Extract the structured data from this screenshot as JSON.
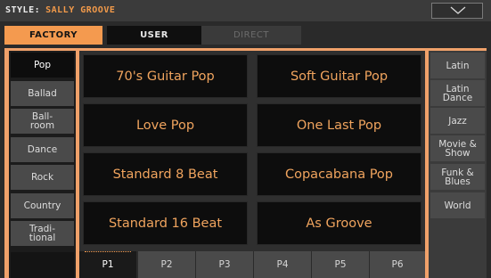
{
  "header": {
    "style_label": "STYLE:",
    "style_name": "SALLY GROOVE",
    "dropdown_icon": "chevron-down-icon"
  },
  "bank_tabs": [
    {
      "label": "FACTORY",
      "state": "selected"
    },
    {
      "label": "USER",
      "state": "normal"
    },
    {
      "label": "DIRECT",
      "state": "disabled"
    }
  ],
  "left_categories": [
    {
      "label": "Pop",
      "selected": true
    },
    {
      "label": "Ballad",
      "selected": false
    },
    {
      "label": "Ball-\nroom",
      "selected": false
    },
    {
      "label": "Dance",
      "selected": false
    },
    {
      "label": "Rock",
      "selected": false
    },
    {
      "label": "Country",
      "selected": false
    },
    {
      "label": "Tradi-\ntional",
      "selected": false
    }
  ],
  "styles": [
    "70's Guitar Pop",
    "Soft Guitar Pop",
    "Love Pop",
    "One Last Pop",
    "Standard 8 Beat",
    "Copacabana Pop",
    "Standard 16 Beat",
    "As Groove"
  ],
  "pages": [
    {
      "label": "P1",
      "selected": true
    },
    {
      "label": "P2",
      "selected": false
    },
    {
      "label": "P3",
      "selected": false
    },
    {
      "label": "P4",
      "selected": false
    },
    {
      "label": "P5",
      "selected": false
    },
    {
      "label": "P6",
      "selected": false
    }
  ],
  "right_categories": [
    "Latin",
    "Latin\nDance",
    "Jazz",
    "Movie &\nShow",
    "Funk &\nBlues",
    "World"
  ],
  "colors": {
    "accent": "#f49a4f",
    "frame": "#f0a16a",
    "style_text": "#f0a45e"
  }
}
